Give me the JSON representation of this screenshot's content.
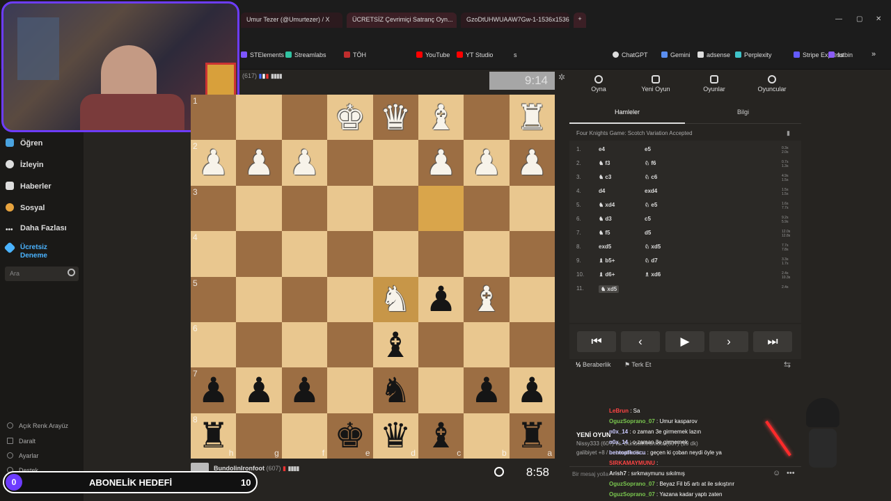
{
  "browser": {
    "tabs": [
      {
        "title": "Umur Tezer (@Umurtezer) / X"
      },
      {
        "title": "ÜCRETSİZ Çevrimiçi Satranç Oyn..."
      },
      {
        "title": "GzoDtUHWUAAW7Gw-1-1536x1536..."
      }
    ],
    "new_tab": "+",
    "bookmarks": [
      "STElements",
      "Streamlabs",
      "TÖH",
      "YouTube",
      "YT Studio",
      "s",
      "ChatGPT",
      "Gemini",
      "adsense",
      "Perplexity",
      "Stripe Express",
      "futbin"
    ],
    "more": "»"
  },
  "nav": {
    "items": [
      {
        "label": "Öğren",
        "color": "#4aa3df"
      },
      {
        "label": "İzleyin",
        "color": "#dddddd"
      },
      {
        "label": "Haberler",
        "color": "#dddddd"
      },
      {
        "label": "Sosyal",
        "color": "#e7a33e"
      },
      {
        "label": "Daha Fazlası",
        "color": "#dddddd"
      }
    ],
    "premium": "Ücretsiz Deneme",
    "premium_color": "#4ab3ff",
    "search_placeholder": "Ara",
    "bottom": [
      "Açık Renk Arayüz",
      "Daralt",
      "Ayarlar",
      "Destek"
    ]
  },
  "game": {
    "opponent": {
      "rating": "(617)",
      "clock": "9:14"
    },
    "player": {
      "name": "BundolinIronfoot",
      "rating": "(607)",
      "clock": "8:58"
    },
    "ranks": [
      "1",
      "2",
      "3",
      "4",
      "5",
      "6",
      "7",
      "8"
    ],
    "files": [
      "h",
      "g",
      "f",
      "e",
      "d",
      "c",
      "b",
      "a"
    ],
    "board": [
      [
        "",
        "",
        "",
        "wK",
        "wQ",
        "wB",
        "",
        "wR"
      ],
      [
        "wP",
        "wP",
        "wP",
        "",
        "",
        "wP",
        "wP",
        "wP"
      ],
      [
        "",
        "",
        "",
        "",
        "",
        "",
        "",
        ""
      ],
      [
        "",
        "",
        "",
        "",
        "",
        "",
        "",
        ""
      ],
      [
        "",
        "",
        "",
        "",
        "wN",
        "bP",
        "wB",
        ""
      ],
      [
        "",
        "",
        "",
        "",
        "bB",
        "",
        "",
        ""
      ],
      [
        "bP",
        "bP",
        "bP",
        "",
        "bN",
        "",
        "bP",
        "bP"
      ],
      [
        "bR",
        "",
        "",
        "bK",
        "bQ",
        "bB",
        "",
        "bR"
      ]
    ],
    "highlight": [
      [
        2,
        5
      ],
      [
        4,
        4
      ]
    ]
  },
  "panel": {
    "tabs": [
      "Oyna",
      "Yeni Oyun",
      "Oyunlar",
      "Oyuncular"
    ],
    "subtabs": [
      "Hamleler",
      "Bilgi"
    ],
    "opening": "Four Knights Game: Scotch Variation Accepted",
    "moves": [
      {
        "n": "1.",
        "w": "e4",
        "b": "e5",
        "t1": "0.3s",
        "t2": "2.0s"
      },
      {
        "n": "2.",
        "w": "♞ f3",
        "b": "♘ f6",
        "t1": "0.7s",
        "t2": "1.3s"
      },
      {
        "n": "3.",
        "w": "♞ c3",
        "b": "♘ c6",
        "t1": "4.9s",
        "t2": "1.5s"
      },
      {
        "n": "4.",
        "w": "d4",
        "b": "exd4",
        "t1": "1.5s",
        "t2": "1.5s"
      },
      {
        "n": "5.",
        "w": "♞ xd4",
        "b": "♘ e5",
        "t1": "1.6s",
        "t2": "7.7s"
      },
      {
        "n": "6.",
        "w": "♞ d3",
        "b": "c5",
        "t1": "9.2s",
        "t2": "5.9s"
      },
      {
        "n": "7.",
        "w": "♞ f5",
        "b": "d5",
        "t1": "12.0s",
        "t2": "12.8s"
      },
      {
        "n": "8.",
        "w": "exd5",
        "b": "♘ xd5",
        "t1": "7.7s",
        "t2": "7.8s"
      },
      {
        "n": "9.",
        "w": "♝ b5+",
        "b": "♘ d7",
        "t1": "3.3s",
        "t2": "1.7s"
      },
      {
        "n": "10.",
        "w": "♝ d6+",
        "b": "♗ xd6",
        "t1": "2.4s",
        "t2": "10.3s"
      },
      {
        "n": "11.",
        "w": "♞ xd5",
        "b": "",
        "t1": "2.4s",
        "t2": ""
      }
    ],
    "controls": [
      "⏮",
      "‹",
      "▶",
      "›",
      "⏭"
    ],
    "draw": "Beraberlik",
    "resign": "Terk Et",
    "message_placeholder": "Bir mesaj yolla"
  },
  "chat": [
    {
      "user": "LeBrun",
      "text": "Sa",
      "color": "#ff4444"
    },
    {
      "user": "OguzSoprano_07",
      "text": "Umur kasparov",
      "color": "#7ac74f"
    },
    {
      "user": "n0x_14",
      "text": "o zaman 3e girmemek lazın",
      "color": "#c9c9ff"
    },
    {
      "user": "n0x_14",
      "text": "o zaman 3e girmemek",
      "color": "#c9c9ff"
    },
    {
      "user": "bentopfkoscu",
      "text": "geçen ki çoban neydi öyle ya",
      "color": "#c9c9ff"
    },
    {
      "user": "SIRKAMAYMUNU",
      "text": "",
      "color": "#ff4444"
    },
    {
      "user": "Arish7",
      "text": "sırkmaymunu sıkılmış",
      "color": "#dddddd"
    },
    {
      "user": "OguzSoprano_07",
      "text": "Beyaz Fil b5 artı at ile sıkıştırır",
      "color": "#7ac74f"
    },
    {
      "user": "OguzSoprano_07",
      "text": "Yazana kadar yaptı zaten",
      "color": "#7ac74f"
    }
  ],
  "overlay": {
    "new_game_label": "YENİ OYUN",
    "nissy_line": "Nissy333 (60?) vs. BundolinIronfoot (607) (10 dk)",
    "galibiyet": "galibiyet +8 / ... beraberlik ..."
  },
  "subgoal": {
    "current": "0",
    "label": "ABONELİK HEDEFİ",
    "target": "10"
  }
}
